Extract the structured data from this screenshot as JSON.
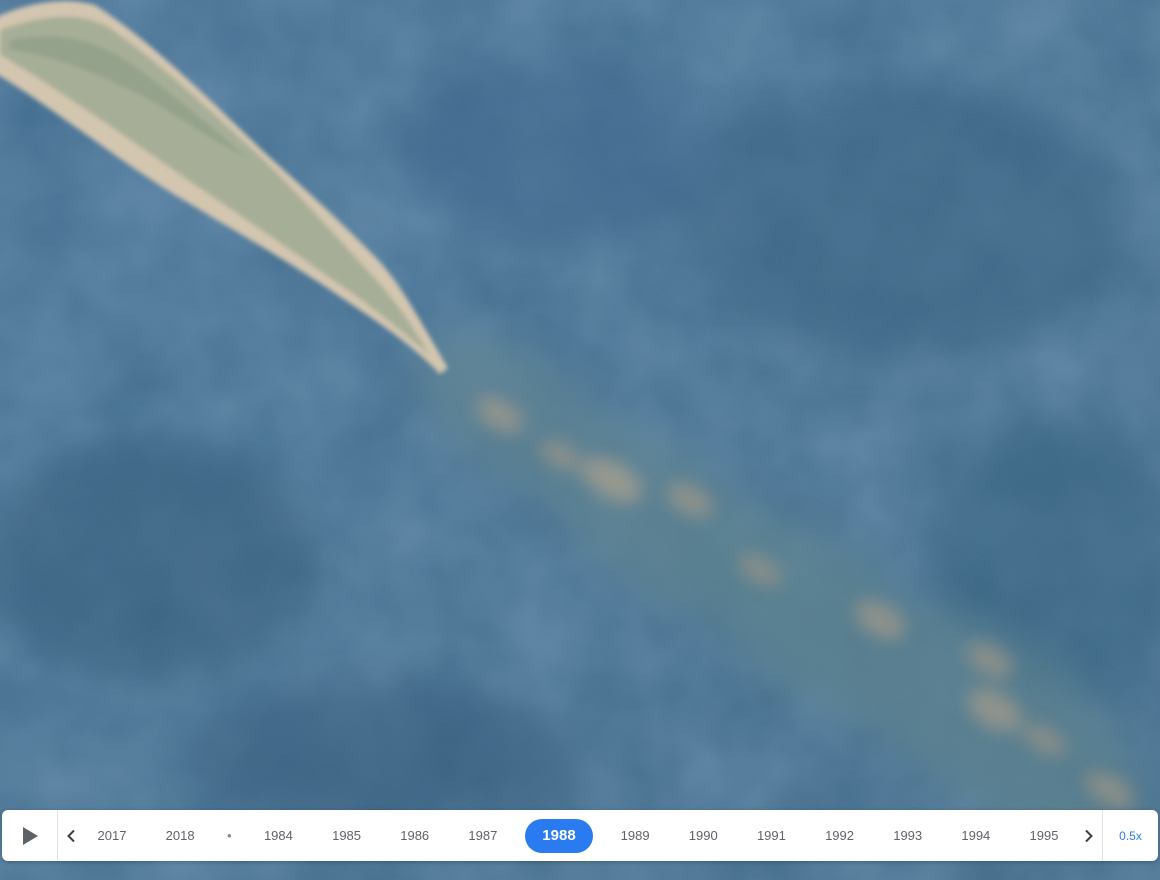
{
  "map": {
    "imagery": "satellite-ocean-sandspit"
  },
  "timeline": {
    "play_icon": "play-icon",
    "prev_icon": "chevron-left-icon",
    "next_icon": "chevron-right-icon",
    "years": [
      {
        "label": "2017",
        "active": false
      },
      {
        "label": "2018",
        "active": false
      },
      {
        "label": "•",
        "active": false
      },
      {
        "label": "1984",
        "active": false
      },
      {
        "label": "1985",
        "active": false
      },
      {
        "label": "1986",
        "active": false
      },
      {
        "label": "1987",
        "active": false
      },
      {
        "label": "1988",
        "active": true
      },
      {
        "label": "1989",
        "active": false
      },
      {
        "label": "1990",
        "active": false
      },
      {
        "label": "1991",
        "active": false
      },
      {
        "label": "1992",
        "active": false
      },
      {
        "label": "1993",
        "active": false
      },
      {
        "label": "1994",
        "active": false
      },
      {
        "label": "1995",
        "active": false
      }
    ],
    "speed": "0.5x",
    "accent_color": "#2b7bf0"
  }
}
